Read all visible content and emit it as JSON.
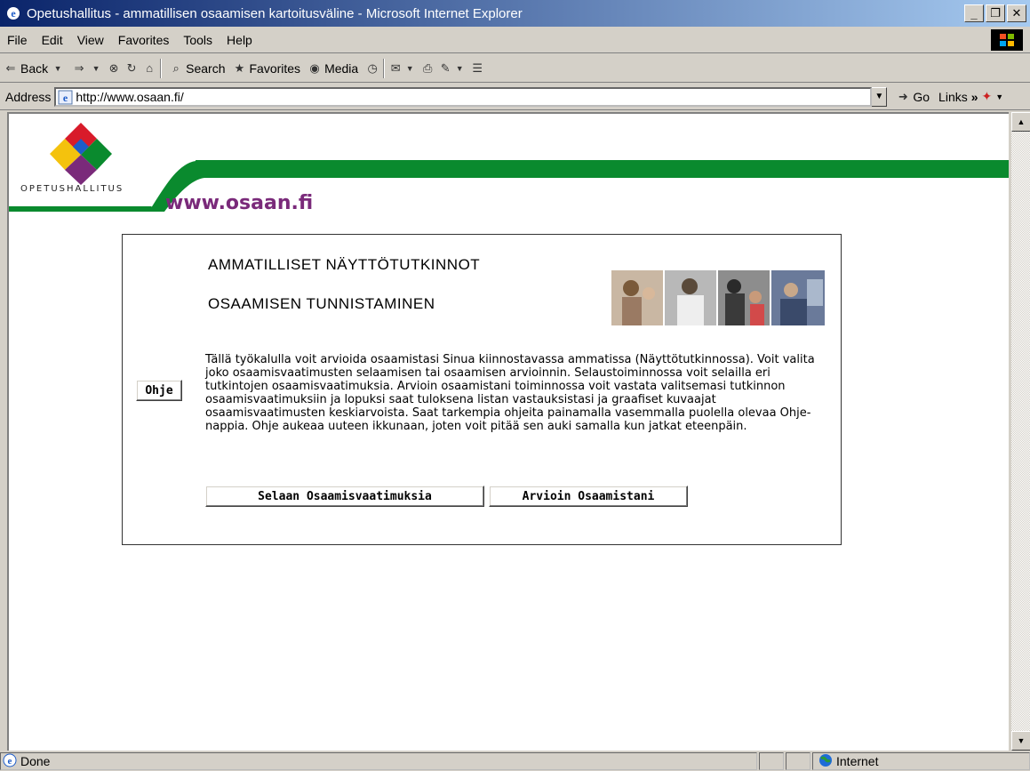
{
  "window": {
    "title": "Opetushallitus - ammatillisen osaamisen kartoitusväline - Microsoft Internet Explorer",
    "controls": {
      "minimize": "_",
      "maximize": "❐",
      "close": "✕"
    }
  },
  "menubar": {
    "items": [
      {
        "label": "File",
        "key": "F"
      },
      {
        "label": "Edit",
        "key": "E"
      },
      {
        "label": "View",
        "key": "V"
      },
      {
        "label": "Favorites",
        "key": "a"
      },
      {
        "label": "Tools",
        "key": "T"
      },
      {
        "label": "Help",
        "key": "H"
      }
    ]
  },
  "toolbar": {
    "back": "Back",
    "search": "Search",
    "favorites": "Favorites",
    "media": "Media"
  },
  "addressbar": {
    "label": "Address",
    "url": "http://www.osaan.fi/",
    "go": "Go",
    "links": "Links"
  },
  "page": {
    "logo_text": "OPETUSHALLITUS",
    "site_url": "www.osaan.fi",
    "heading1": "AMMATILLISET NÄYTTÖTUTKINNOT",
    "heading2": "OSAAMISEN TUNNISTAMINEN",
    "help_button": "Ohje",
    "description": "Tällä työkalulla voit arvioida osaamistasi Sinua kiinnostavassa ammatissa (Näyttötutkinnossa). Voit valita joko osaamisvaatimusten selaamisen tai osaamisen arvioinnin. Selaustoiminnossa voit selailla eri tutkintojen osaamisvaatimuksia. Arvioin osaamistani toiminnossa voit vastata valitsemasi tutkinnon osaamisvaatimuksiin ja lopuksi saat tuloksena listan vastauksistasi ja graafiset kuvaajat osaamisvaatimusten keskiarvoista. Saat tarkempia ohjeita painamalla vasemmalla puolella olevaa Ohje-nappia. Ohje aukeaa uuteen ikkunaan, joten voit pitää sen auki samalla kun jatkat eteenpäin.",
    "browse_button": "Selaan Osaamisvaatimuksia",
    "assess_button": "Arvioin Osaamistani"
  },
  "statusbar": {
    "status": "Done",
    "zone": "Internet"
  },
  "colors": {
    "brand_green": "#0a8a2e",
    "brand_purple": "#7a2a7a",
    "titlebar_start": "#0a246a",
    "titlebar_end": "#a6caf0"
  }
}
